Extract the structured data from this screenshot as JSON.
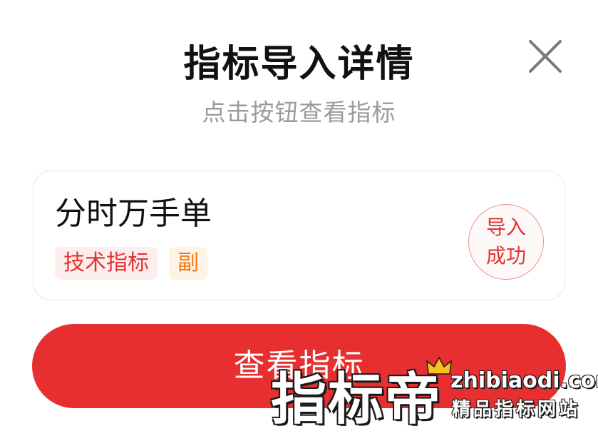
{
  "dialog": {
    "title": "指标导入详情",
    "subtitle": "点击按钮查看指标",
    "close_icon": "close-icon"
  },
  "card": {
    "name": "分时万手单",
    "tags": [
      "技术指标",
      "副"
    ],
    "status_line1": "导入",
    "status_line2": "成功"
  },
  "actions": {
    "view_label": "查看指标"
  },
  "watermark": {
    "brand": "指标帝",
    "domain": "zhibiaodi.com",
    "slogan": "精品指标网站",
    "crown_icon": "crown-icon"
  },
  "colors": {
    "accent": "#e72f30",
    "tag_type_text": "#e3322f",
    "tag_type_bg": "#fdeeee",
    "tag_sub_text": "#f07b12",
    "tag_sub_bg": "#fff3e6",
    "subtitle": "#9b9b9b"
  }
}
